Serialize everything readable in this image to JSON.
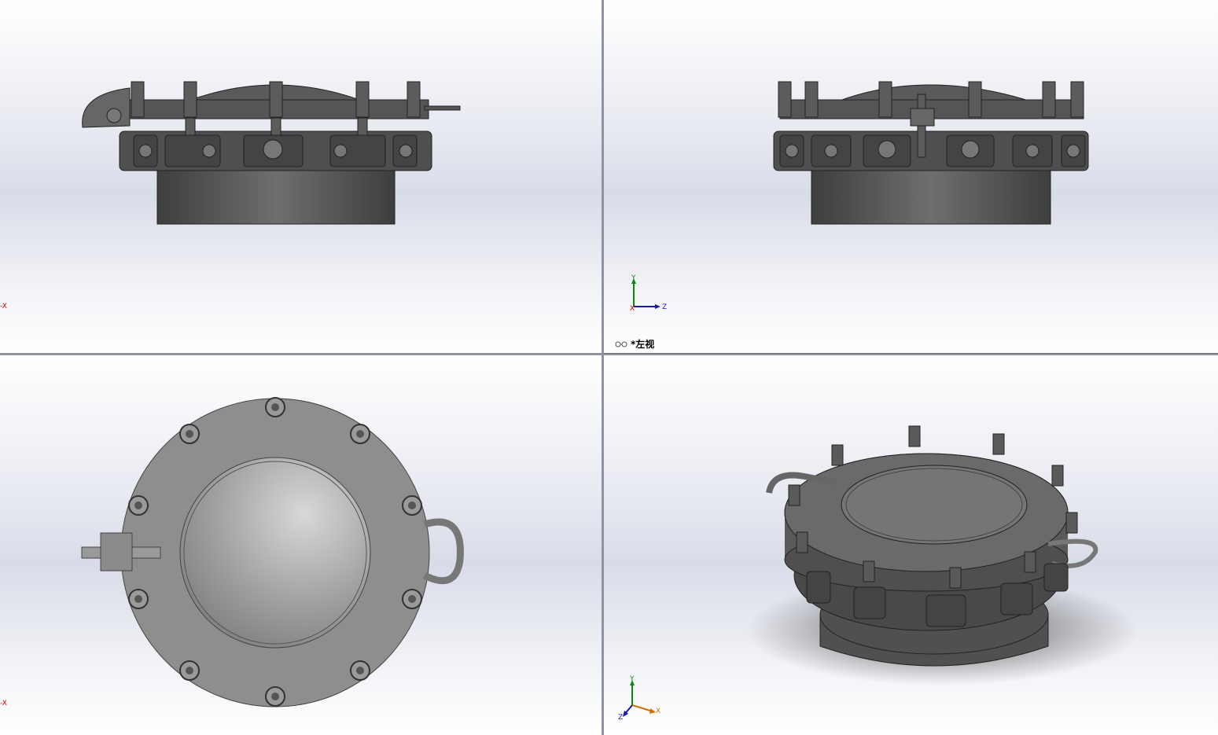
{
  "viewports": {
    "top_left": {
      "axis_mark": "-X"
    },
    "top_right": {
      "view_name": "*左视",
      "triad": {
        "y": "Y",
        "z": "Z",
        "x": "X"
      }
    },
    "bottom_left": {
      "axis_mark": "-X"
    },
    "bottom_right": {
      "triad": {
        "y": "Y",
        "x": "X",
        "z": "Z"
      }
    }
  },
  "colors": {
    "part_dark": "#4a4a4a",
    "part_mid": "#6b6b6b",
    "part_light": "#9a9a9a",
    "axis_x": "#cc0000",
    "axis_y": "#0a8a0a",
    "axis_z": "#1a1aaa",
    "splitter": "#8d93a3"
  }
}
